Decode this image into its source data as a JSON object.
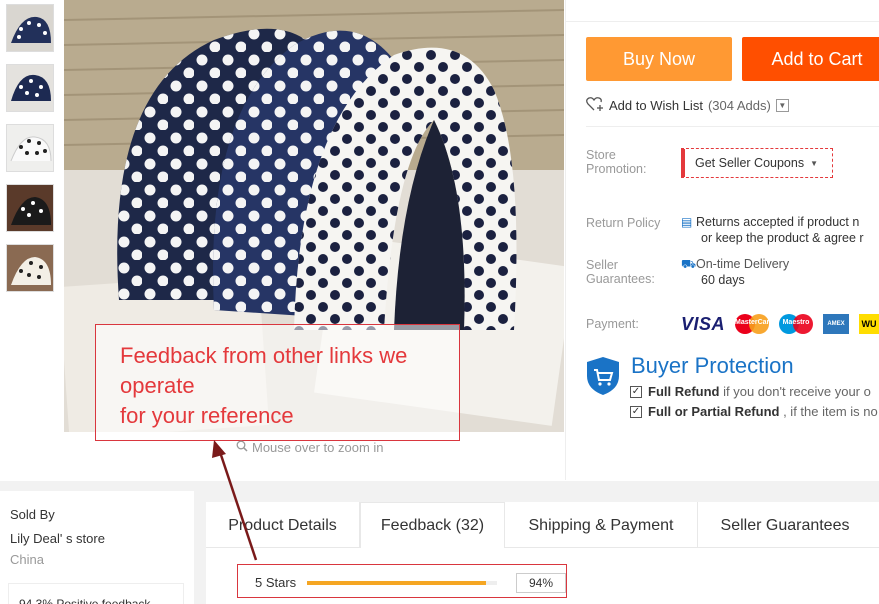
{
  "thumbnails": [
    {
      "name": "thumb-1"
    },
    {
      "name": "thumb-2"
    },
    {
      "name": "thumb-3"
    },
    {
      "name": "thumb-4"
    },
    {
      "name": "thumb-5"
    }
  ],
  "overlay": {
    "text": "Feedback from other links we\noperate\nfor your reference"
  },
  "zoom_hint": "Mouse over to zoom in",
  "actions": {
    "buy_now": "Buy Now",
    "add_to_cart": "Add to Cart"
  },
  "wishlist": {
    "label": "Add to Wish List",
    "count": "(304 Adds)"
  },
  "store_promotion": {
    "label_line1": "Store",
    "label_line2": "Promotion:",
    "coupon": "Get Seller Coupons"
  },
  "return_policy": {
    "label": "Return Policy",
    "line1": "Returns accepted if product n",
    "line2": "or keep the product & agree r"
  },
  "seller_guarantees": {
    "label_line1": "Seller",
    "label_line2": "Guarantees:",
    "line1": "On-time Delivery",
    "line2": "60 days"
  },
  "payment": {
    "label": "Payment:",
    "visa": "VISA",
    "mastercard": "MasterCard",
    "maestro": "Maestro",
    "amex": "AMEX",
    "wu": "WU"
  },
  "buyer_protection": {
    "title": "Buyer Protection",
    "items": [
      {
        "bold": "Full Refund",
        "rest": " if you don't receive your o"
      },
      {
        "bold": "Full or Partial Refund",
        "rest": " , if the item is no"
      }
    ]
  },
  "seller": {
    "sold_by": "Sold By",
    "store_name": "Lily Deal' s store",
    "country": "China",
    "positive_feedback": "94.3%  Positive feedback"
  },
  "tabs": [
    {
      "label": "Product Details"
    },
    {
      "label": "Feedback (32)"
    },
    {
      "label": "Shipping & Payment"
    },
    {
      "label": "Seller Guarantees"
    }
  ],
  "rating": {
    "label": "5 Stars",
    "percent_text": "94%",
    "percent": 94
  },
  "colors": {
    "buy_now": "#ff9933",
    "add_to_cart": "#ff4f00",
    "accent_red": "#e4393c",
    "accent_blue": "#1a73c6",
    "rating_fill": "#f5a623"
  }
}
